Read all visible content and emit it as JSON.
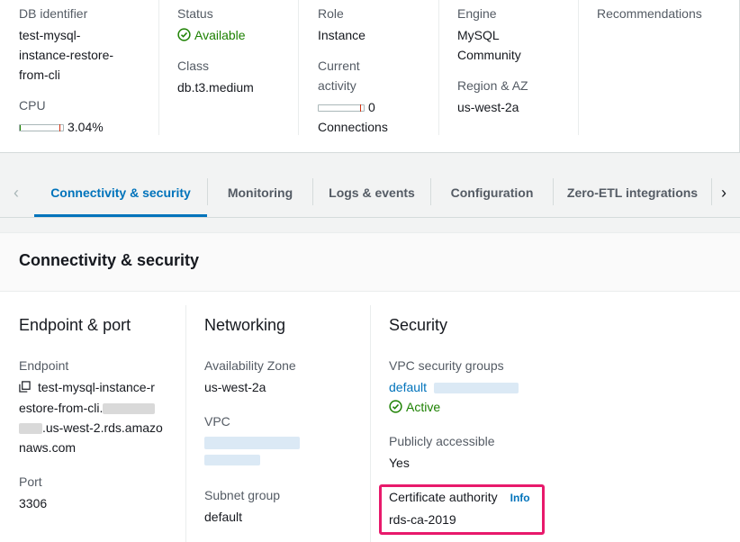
{
  "summary": {
    "db_identifier": {
      "label": "DB identifier",
      "value_lines": [
        "test-mysql-",
        "instance-restore-",
        "from-cli"
      ]
    },
    "cpu": {
      "label": "CPU",
      "value": "3.04%",
      "fraction": 0.0304
    },
    "status": {
      "label": "Status",
      "value": "Available"
    },
    "class": {
      "label": "Class",
      "value": "db.t3.medium"
    },
    "role": {
      "label": "Role",
      "value": "Instance"
    },
    "activity": {
      "label_lines": [
        "Current",
        "activity"
      ],
      "count": "0",
      "unit": "Connections"
    },
    "engine": {
      "label": "Engine",
      "value_lines": [
        "MySQL",
        "Community"
      ]
    },
    "region": {
      "label": "Region & AZ",
      "value": "us-west-2a"
    },
    "recommendations": {
      "label": "Recommendations"
    }
  },
  "tabs": [
    {
      "label": "Connectivity & security",
      "active": true
    },
    {
      "label": "Monitoring",
      "active": false
    },
    {
      "label": "Logs & events",
      "active": false
    },
    {
      "label": "Configuration",
      "active": false
    },
    {
      "label": "Zero-ETL integrations",
      "active": false
    }
  ],
  "panel": {
    "title": "Connectivity & security",
    "endpoint_port": {
      "title": "Endpoint & port",
      "endpoint_label": "Endpoint",
      "endpoint_lines": [
        "test-mysql-instance-r",
        "estore-from-cli.",
        ".us-west-2.rds.amazo",
        "naws.com"
      ],
      "port_label": "Port",
      "port_value": "3306"
    },
    "networking": {
      "title": "Networking",
      "az_label": "Availability Zone",
      "az_value": "us-west-2a",
      "vpc_label": "VPC",
      "subnet_label": "Subnet group",
      "subnet_value": "default"
    },
    "security": {
      "title": "Security",
      "vpc_sg_label": "VPC security groups",
      "vpc_sg_link": "default",
      "vpc_sg_status": "Active",
      "public_label": "Publicly accessible",
      "public_value": "Yes",
      "ca_label": "Certificate authority",
      "ca_info": "Info",
      "ca_value": "rds-ca-2019"
    }
  },
  "colors": {
    "accent": "#0073bb",
    "success": "#1d8102",
    "highlight": "#e8196b"
  }
}
